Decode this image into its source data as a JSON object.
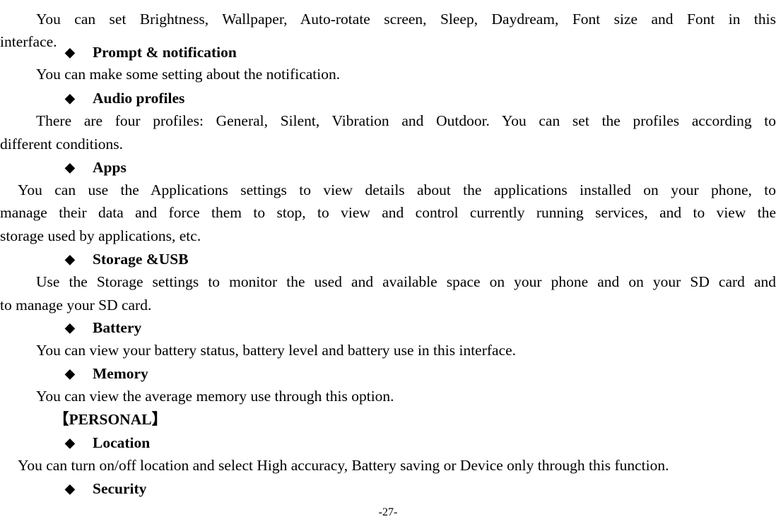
{
  "page_number": "-27-",
  "bullet_glyph": "◆",
  "lines": [
    {
      "id": "display-p1a",
      "text": "You can set Brightness, Wallpaper, Auto-rotate screen, Sleep, Daydream, Font size and Font in this"
    },
    {
      "id": "display-p1b",
      "text": "interface."
    },
    {
      "id": "h-prompt",
      "text": "Prompt & notification"
    },
    {
      "id": "prompt-p",
      "text": "You can make some setting about the notification."
    },
    {
      "id": "h-audio",
      "text": "Audio profiles"
    },
    {
      "id": "audio-pa",
      "text": "There are four profiles: General, Silent, Vibration and Outdoor. You can set the profiles according to"
    },
    {
      "id": "audio-pb",
      "text": "different conditions."
    },
    {
      "id": "h-apps",
      "text": "Apps"
    },
    {
      "id": "apps-pa",
      "text": "You can use the Applications settings to view details about the applications installed on your phone, to"
    },
    {
      "id": "apps-pb",
      "text": "manage their data and force them to stop, to view and control currently running services, and to view the"
    },
    {
      "id": "apps-pc",
      "text": "storage used by applications, etc."
    },
    {
      "id": "h-storage",
      "text": "Storage &USB"
    },
    {
      "id": "storage-pa",
      "text": "Use the Storage settings to monitor the used and available space on your phone and on your SD card and"
    },
    {
      "id": "storage-pb",
      "text": "to manage your SD card."
    },
    {
      "id": "h-battery",
      "text": "Battery"
    },
    {
      "id": "battery-p",
      "text": "You can view your battery status, battery level and battery use in this interface."
    },
    {
      "id": "h-memory",
      "text": "Memory"
    },
    {
      "id": "memory-p",
      "text": "You can view the average memory use through this option."
    },
    {
      "id": "section-personal",
      "text": "【PERSONAL】"
    },
    {
      "id": "h-location",
      "text": "Location"
    },
    {
      "id": "location-p",
      "text": "You can turn on/off location and select High accuracy, Battery saving or Device only through this function."
    },
    {
      "id": "h-security",
      "text": "Security"
    }
  ]
}
